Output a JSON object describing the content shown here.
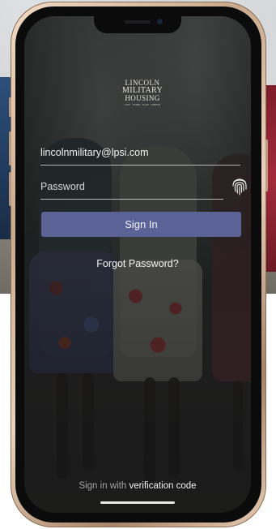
{
  "logo": {
    "line1": "LINCOLN",
    "line2": "MILITARY",
    "line3": "HOUSING",
    "tagline": "LIVE · WORK · PLAY · THRIVE"
  },
  "login": {
    "email_value": "lincolnmilitary@lpsi.com",
    "password_placeholder": "Password",
    "signin_label": "Sign In",
    "forgot_label": "Forgot Password?"
  },
  "footer": {
    "prefix": "Sign in with",
    "link": "verification code"
  },
  "icons": {
    "fingerprint": "fingerprint-icon"
  },
  "colors": {
    "button": "#5b6296",
    "frame": "#c9a98c"
  }
}
